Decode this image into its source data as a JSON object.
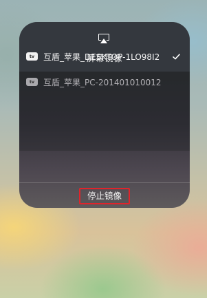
{
  "screen_mirroring": {
    "title": "屏幕镜像",
    "header_icon": "airplay-icon",
    "devices": [
      {
        "badge": "tv",
        "name": "互盾_苹果_DESKTOP-1LO98I2",
        "selected": true,
        "indicator_icon": "checkmark-icon"
      },
      {
        "badge": "tv",
        "name": "互盾_苹果_PC-201401010012",
        "selected": false
      }
    ],
    "stop_button_label": "停止镜像",
    "colors": {
      "highlight_border": "#e0242b",
      "panel_background": "#2b2d31",
      "text": "#f4f4f4"
    }
  }
}
